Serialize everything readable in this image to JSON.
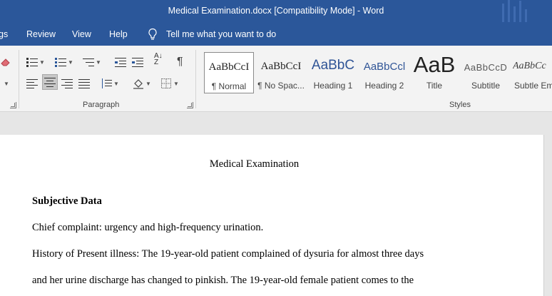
{
  "window": {
    "title": "Medical Examination.docx [Compatibility Mode]  -  Word"
  },
  "menu": {
    "items": [
      "gs",
      "Review",
      "View",
      "Help"
    ],
    "tell_me": "Tell me what you want to do",
    "tell_me_icon": "lightbulb-icon"
  },
  "ribbon": {
    "paragraph_group": {
      "label": "Paragraph",
      "alignment_selected": "center"
    },
    "styles_group": {
      "label": "Styles",
      "items": [
        {
          "sample": "AaBbCcI",
          "name": "¶ Normal",
          "selected": true
        },
        {
          "sample": "AaBbCcI",
          "name": "¶ No Spac..."
        },
        {
          "sample": "AaBbC",
          "name": "Heading 1"
        },
        {
          "sample": "AaBbCcl",
          "name": "Heading 2"
        },
        {
          "sample": "AaB",
          "name": "Title"
        },
        {
          "sample": "AaBbCcD",
          "name": "Subtitle"
        },
        {
          "sample": "AaBbCc",
          "name": "Subtle Em"
        }
      ]
    }
  },
  "document": {
    "title": "Medical Examination",
    "heading": "Subjective Data",
    "lines": [
      "Chief complaint: urgency and high-frequency urination.",
      "History of Present illness: The 19-year-old patient complained of dysuria for almost three days",
      "and her urine discharge has changed to pinkish. The 19-year-old female patient comes to the"
    ]
  },
  "colors": {
    "title_bar": "#2b579a",
    "ribbon": "#f3f3f3",
    "heading1": "#2f5496",
    "heading2": "#2f5496",
    "subtitle": "#595959"
  }
}
